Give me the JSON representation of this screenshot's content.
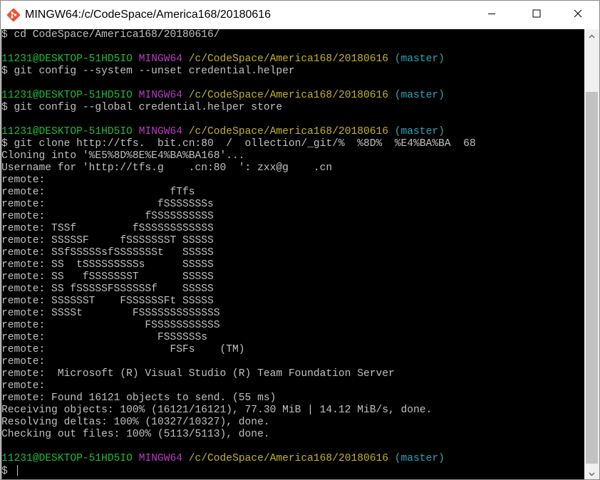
{
  "window": {
    "title": "MINGW64:/c/CodeSpace/America168/20180616",
    "icon": "git-bash-icon"
  },
  "controls": {
    "minimize": "minimize-icon",
    "maximize": "maximize-icon",
    "close": "close-icon"
  },
  "colors": {
    "user": "#1fba3a",
    "mingw": "#b83cc4",
    "path": "#c2b226",
    "branch": "#2aa6b8",
    "text": "#c0c0c0",
    "background": "#000000"
  },
  "prompt": {
    "user": "11231@DESKTOP-51HD5IO",
    "env": "MINGW64",
    "path": "/c/CodeSpace/America168/20180616",
    "branch": "(master)"
  },
  "lines": [
    "$ cd CodeSpace/America168/20180616/",
    "",
    "__PROMPT__",
    "$ git config --system --unset credential.helper",
    "",
    "__PROMPT__",
    "$ git config --global credential.helper store",
    "",
    "__PROMPT__",
    "$ git clone http://tfs.  bit.cn:80  /  ollection/_git/%  %8D%  %E4%BA%BA  68",
    "Cloning into '%E5%8D%8E%E4%BA%BA168'...",
    "Username for 'http://tfs.g    .cn:80  ': zxx@g    .cn",
    "remote:",
    "remote:                    fTfs",
    "remote:                  fSSSSSSSs",
    "remote:                fSSSSSSSSSS",
    "remote: TSSf         fSSSSSSSSSSSS",
    "remote: SSSSSF     fSSSSSSST SSSSS",
    "remote: SSfSSSSSsfSSSSSSSt   SSSSS",
    "remote: SS  tSSSSSSSSSs      SSSSS",
    "remote: SS   fSSSSSSST       SSSSS",
    "remote: SS fSSSSSFSSSSSSf    SSSSS",
    "remote: SSSSSST    FSSSSSSFt SSSSS",
    "remote: SSSSt        FSSSSSSSSSSSSS",
    "remote:                FSSSSSSSSSSS",
    "remote:                  FSSSSSSs",
    "remote:                    FSFs    (TM)",
    "remote:",
    "remote:  Microsoft (R) Visual Studio (R) Team Foundation Server",
    "remote:",
    "remote: Found 16121 objects to send. (55 ms)",
    "Receiving objects: 100% (16121/16121), 77.30 MiB | 14.12 MiB/s, done.",
    "Resolving deltas: 100% (10327/10327), done.",
    "Checking out files: 100% (5113/5113), done.",
    "",
    "__PROMPT__",
    "$ "
  ]
}
